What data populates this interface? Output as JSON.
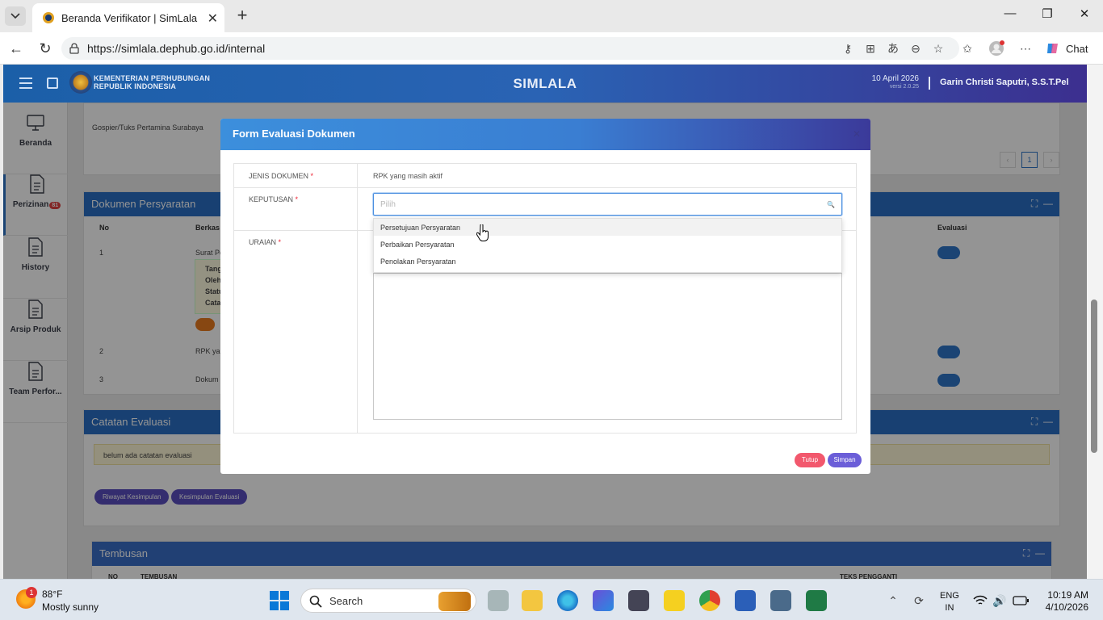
{
  "browser": {
    "tab_title": "Beranda Verifikator | SimLala",
    "url": "https://simlala.dephub.go.id/internal",
    "chat_label": "Chat"
  },
  "app": {
    "ministry_line1": "KEMENTERIAN PERHUBUNGAN",
    "ministry_line2": "REPUBLIK INDONESIA",
    "brand": "SIMLALA",
    "date": "10 April 2026",
    "version": "versi 2.0.25",
    "user": "Garin Christi Saputri, S.S.T.Pel"
  },
  "sidebar": {
    "items": [
      {
        "label": "Beranda"
      },
      {
        "label": "Perizinan",
        "badge": "81"
      },
      {
        "label": "History"
      },
      {
        "label": "Arsip Produk"
      },
      {
        "label": "Team Perfor..."
      }
    ]
  },
  "background": {
    "location_text": "Gospier/Tuks Pertamina Surabaya",
    "page_number": "1",
    "dokumen_title": "Dokumen Persyaratan",
    "col_no": "No",
    "col_berkas": "Berkas",
    "col_evaluasi": "Evaluasi",
    "rows": [
      {
        "no": "1",
        "berkas": "Surat Pe"
      },
      {
        "no": "2",
        "berkas": "RPK yar"
      },
      {
        "no": "3",
        "berkas": "Dokum"
      }
    ],
    "detail_lines": [
      "Tang",
      "Oleh",
      "Statu",
      "Cata"
    ],
    "catatan_title": "Catatan Evaluasi",
    "catatan_text": "belum ada catatan evaluasi",
    "btn_riwayat": "Riwayat Kesimpulan",
    "btn_kesimpulan": "Kesimpulan Evaluasi",
    "tembusan_title": "Tembusan",
    "tembusan_col_no": "NO",
    "tembusan_col_tembusan": "TEMBUSAN",
    "tembusan_col_teks": "TEKS PENGGANTI"
  },
  "modal": {
    "title": "Form Evaluasi Dokumen",
    "jenis_label": "JENIS DOKUMEN",
    "jenis_value": "RPK yang masih aktif",
    "keputusan_label": "KEPUTUSAN",
    "keputusan_placeholder": "Pilih",
    "options": [
      "Persetujuan Persyaratan",
      "Perbaikan Persyaratan",
      "Penolakan Persyaratan"
    ],
    "uraian_label": "URAIAN",
    "required_mark": "*",
    "close_label": "Tutup",
    "save_label": "Simpan"
  },
  "taskbar": {
    "temperature": "88°F",
    "weather": "Mostly sunny",
    "weather_badge": "1",
    "search_label": "Search",
    "lang": "ENG",
    "region": "IN",
    "time": "10:19 AM",
    "date": "4/10/2026"
  },
  "colors": {
    "accent": "#2f76c9",
    "modal_header": "#3a7ed2",
    "danger": "#f2586d",
    "primary_button": "#6b5ed8"
  }
}
